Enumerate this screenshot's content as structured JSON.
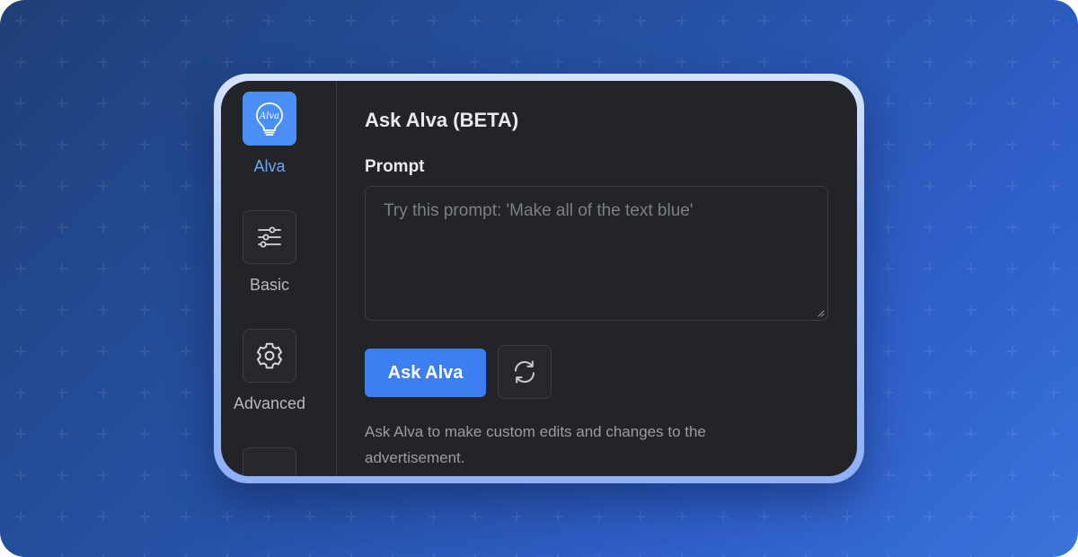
{
  "sidebar": {
    "items": [
      {
        "label": "Alva",
        "icon": "lightbulb-icon",
        "active": true
      },
      {
        "label": "Basic",
        "icon": "sliders-icon",
        "active": false
      },
      {
        "label": "Advanced",
        "icon": "gear-icon",
        "active": false
      },
      {
        "label": "",
        "icon": "more-icon",
        "active": false
      }
    ],
    "logo_text": "Alva"
  },
  "main": {
    "title": "Ask Alva (BETA)",
    "prompt_label": "Prompt",
    "prompt_placeholder": "Try this prompt: 'Make all of the text blue'",
    "prompt_value": "",
    "ask_button_label": "Ask Alva",
    "refresh_icon": "refresh-icon",
    "helper_text": "Ask Alva to make custom edits and changes to the advertisement."
  },
  "colors": {
    "accent": "#3d7ff0",
    "active_label": "#6aa5f7",
    "panel_bg": "#232427",
    "background_start": "#1f3f77",
    "background_end": "#3a73db"
  }
}
